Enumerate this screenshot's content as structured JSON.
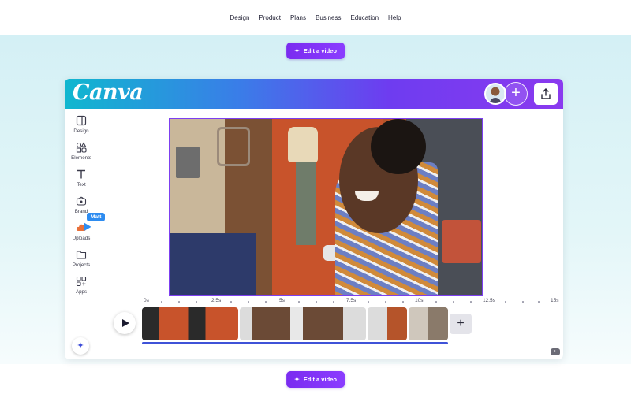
{
  "nav": {
    "items": [
      "Design",
      "Product",
      "Plans",
      "Business",
      "Education",
      "Help"
    ]
  },
  "cta": {
    "label": "Edit a video"
  },
  "editor": {
    "logo": "Canva",
    "sidebar": [
      {
        "label": "Design",
        "icon": "design-icon"
      },
      {
        "label": "Elements",
        "icon": "elements-icon"
      },
      {
        "label": "Text",
        "icon": "text-icon"
      },
      {
        "label": "Brand",
        "icon": "brand-icon"
      },
      {
        "label": "Uploads",
        "icon": "uploads-icon"
      },
      {
        "label": "Projects",
        "icon": "projects-icon"
      },
      {
        "label": "Apps",
        "icon": "apps-icon"
      }
    ],
    "collaborator_tag": "Matt",
    "timeline": {
      "ticks": [
        "0s",
        "2.5s",
        "5s",
        "7.5s",
        "10s",
        "12.5s",
        "15s"
      ],
      "add_label": "+"
    }
  },
  "colors": {
    "accent": "#8b3dff",
    "header_start": "#10b7cf",
    "header_end": "#8a3aef",
    "progress": "#3f52d8"
  }
}
